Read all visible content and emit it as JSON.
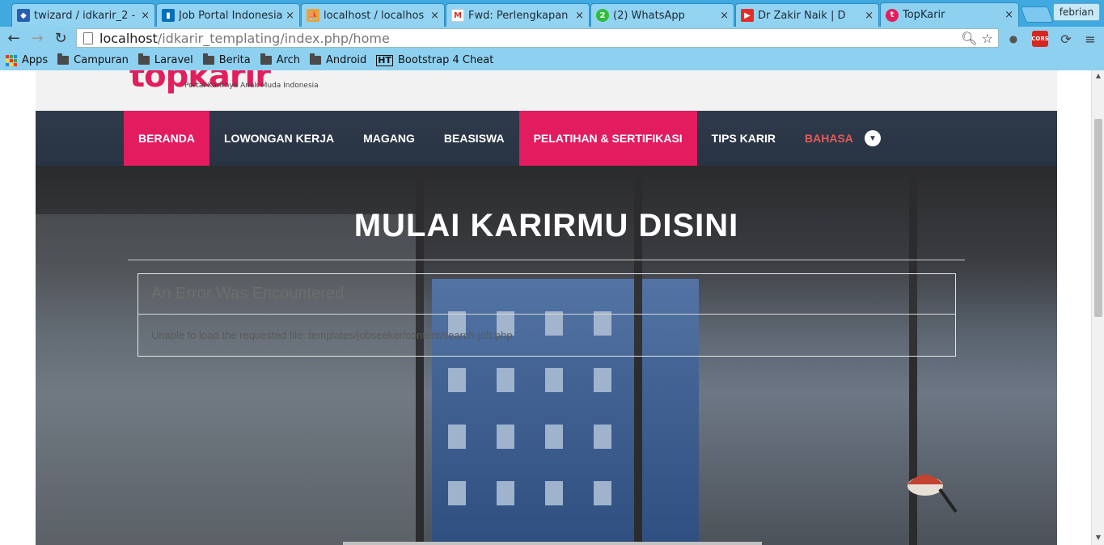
{
  "browser": {
    "tabs": [
      {
        "title": "twizard / idkarir_2 -",
        "icon": "bitbucket-icon",
        "color": "#2a5fb0"
      },
      {
        "title": "Job Portal Indonesia",
        "icon": "trello-icon",
        "color": "#0a6fb8"
      },
      {
        "title": "localhost / localhos",
        "icon": "phpmyadmin-icon",
        "color": "#e8a33d"
      },
      {
        "title": "Fwd: Perlengkapan",
        "icon": "gmail-icon",
        "color": "#ffffff"
      },
      {
        "title": "(2) WhatsApp",
        "icon": "whatsapp-icon",
        "color": "#2fbe3b"
      },
      {
        "title": "Dr Zakir Naik | D",
        "icon": "youtube-icon",
        "color": "#e52d27"
      },
      {
        "title": "TopKarir",
        "icon": "topkarir-icon",
        "color": "#e21e5c"
      }
    ],
    "close_glyph": "×",
    "profile_name": "febrian",
    "address": {
      "host": "localhost",
      "path": "/idkarir_templating/index.php/home"
    },
    "bookmarks": [
      {
        "label": "Apps",
        "type": "apps"
      },
      {
        "label": "Campuran",
        "type": "folder"
      },
      {
        "label": "Laravel",
        "type": "folder"
      },
      {
        "label": "Berita",
        "type": "folder"
      },
      {
        "label": "Arch",
        "type": "folder"
      },
      {
        "label": "Android",
        "type": "folder"
      },
      {
        "label": "Bootstrap 4 Cheat",
        "type": "ht",
        "prefix": "HT"
      }
    ],
    "extensions": {
      "cors_label": "CORS"
    }
  },
  "site": {
    "logo_text": "topkarir",
    "tagline": "Portal Karirnya Anak Muda Indonesia",
    "nav": [
      {
        "label": "BERANDA",
        "highlight": true
      },
      {
        "label": "LOWONGAN KERJA",
        "highlight": false
      },
      {
        "label": "MAGANG",
        "highlight": false
      },
      {
        "label": "BEASISWA",
        "highlight": false
      },
      {
        "label": "PELATIHAN & SERTIFIKASI",
        "highlight": true
      },
      {
        "label": "TIPS KARIR",
        "highlight": false
      },
      {
        "label": "BAHASA",
        "highlight": false,
        "dropdown": true
      }
    ],
    "hero_title": "MULAI KARIRMU DISINI",
    "error": {
      "heading": "An Error Was Encountered",
      "message": "Unable to load the requested file: templates/jobseeker/content/search-job.php"
    }
  },
  "colors": {
    "brand": "#e21e5c",
    "nav_bg": "#2f3b4c",
    "chrome": "#8ed0f0"
  }
}
